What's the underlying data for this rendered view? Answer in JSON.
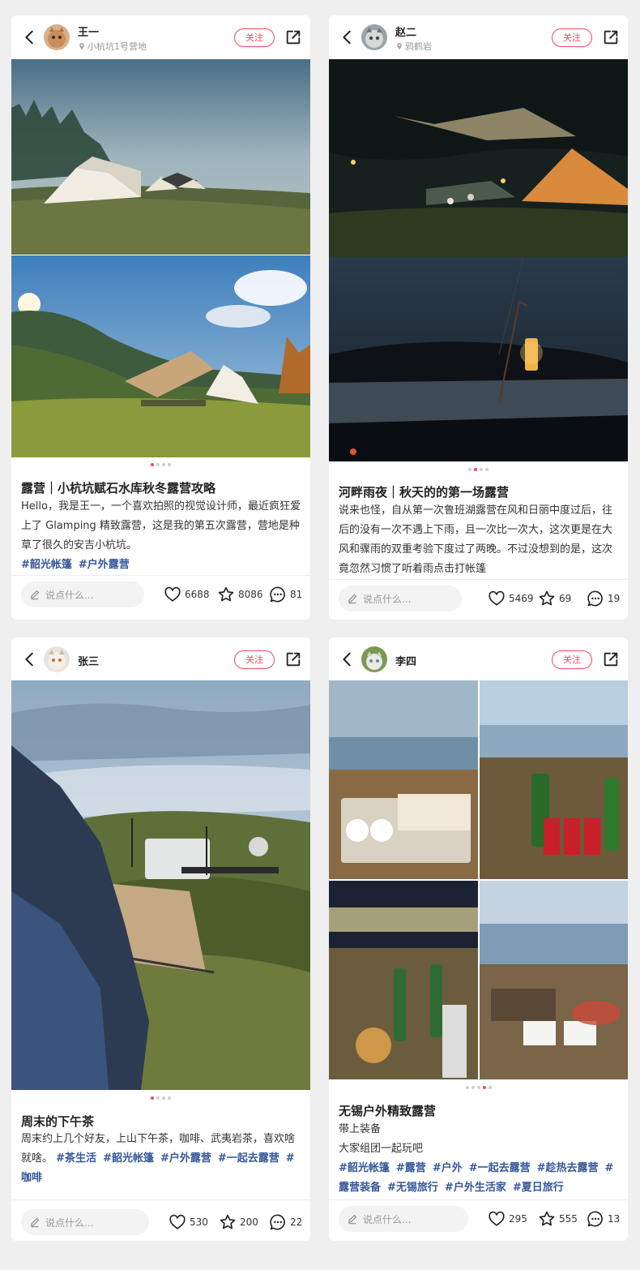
{
  "colors": {
    "accent": "#f04a5e",
    "tag": "#35579a",
    "background": "#efefef"
  },
  "icons": [
    "back-arrow-icon",
    "location-pin-icon",
    "share-icon",
    "pencil-icon",
    "heart-icon",
    "star-icon",
    "comment-icon"
  ],
  "posts": [
    {
      "user": "王一",
      "location": "小杭坑1号营地",
      "follow_label": "关注",
      "title": "露营｜小杭坑赋石水库秋冬露营攻略",
      "body": "Hello，我是王一，一个喜欢拍照的视觉设计师，最近疯狂爱上了 Glamping 精致露营，这是我的第五次露营，营地是种草了很久的安吉小杭坑。",
      "tags": [
        "#韶光帐篷",
        "#户外露营"
      ],
      "comment_placeholder": "说点什么...",
      "likes": "6688",
      "stars": "8086",
      "comments": "81",
      "carousel_active": 1,
      "carousel_total": 4
    },
    {
      "user": "赵二",
      "location": "鸦鹤岩",
      "follow_label": "关注",
      "title": "河畔雨夜｜秋天的的第一场露营",
      "body": "说来也怪，自从第一次鲁班湖露营在风和日丽中度过后，往后的没有一次不遇上下雨，且一次比一次大，这次更是在大风和骤雨的双重考验下度过了两晚。不过没想到的是，这次竟忽然习惯了听着雨点击打帐篷",
      "tags": [],
      "comment_placeholder": "说点什么...",
      "likes": "5469",
      "stars": "69",
      "comments": "19",
      "carousel_active": 2,
      "carousel_total": 4
    },
    {
      "user": "张三",
      "follow_label": "关注",
      "title": "周末的下午茶",
      "body": "周末约上几个好友，上山下午茶，咖啡、武夷岩茶，喜欢啥就啥。",
      "tags": [
        "#茶生活",
        "#韶光帐篷",
        "#户外露营",
        "#一起去露营",
        "#咖啡"
      ],
      "comment_placeholder": "说点什么...",
      "likes": "530",
      "stars": "200",
      "comments": "22",
      "carousel_active": 1,
      "carousel_total": 4
    },
    {
      "user": "李四",
      "follow_label": "关注",
      "title": "无锡户外精致露营",
      "body_lines": [
        "带上装备",
        "大家组团一起玩吧"
      ],
      "tags": [
        "#韶光帐篷",
        "#露营",
        "#户外",
        "#一起去露营",
        "#趁热去露营",
        "#露营装备",
        "#无锡旅行",
        "#户外生活家",
        "#夏日旅行"
      ],
      "comment_placeholder": "说点什么...",
      "likes": "295",
      "stars": "555",
      "comments": "13",
      "carousel_active": 4,
      "carousel_total": 5
    }
  ]
}
